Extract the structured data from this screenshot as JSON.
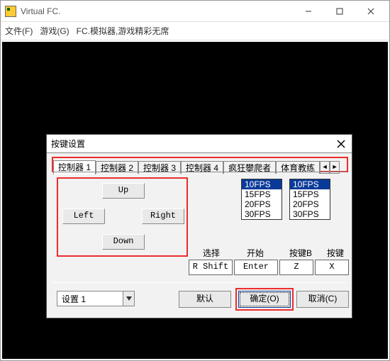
{
  "window": {
    "title": "Virtual FC."
  },
  "menu": {
    "file": "文件(F)",
    "game": "游戏(G)",
    "emulator": "FC.模拟器,游戏精彩无席"
  },
  "dialog": {
    "title": "按键设置",
    "tabs": [
      "控制器 1",
      "控制器 2",
      "控制器 3",
      "控制器 4",
      "疯狂攀爬者",
      "体育教练"
    ],
    "dpad": {
      "up": "Up",
      "down": "Down",
      "left": "Left",
      "right": "Right"
    },
    "fps_options": [
      "10FPS",
      "15FPS",
      "20FPS",
      "30FPS"
    ],
    "fps_selected": "10FPS",
    "labels": {
      "select": "选择",
      "start": "开始",
      "btn_b": "按键B",
      "btn_a": "按键A"
    },
    "values": {
      "select": "R Shift",
      "start": "Enter",
      "btn_b": "Z",
      "btn_a": "X"
    },
    "profile": {
      "label": "设置 1"
    },
    "buttons": {
      "default": "默认",
      "ok": "确定(O)",
      "cancel": "取消(C)"
    }
  }
}
